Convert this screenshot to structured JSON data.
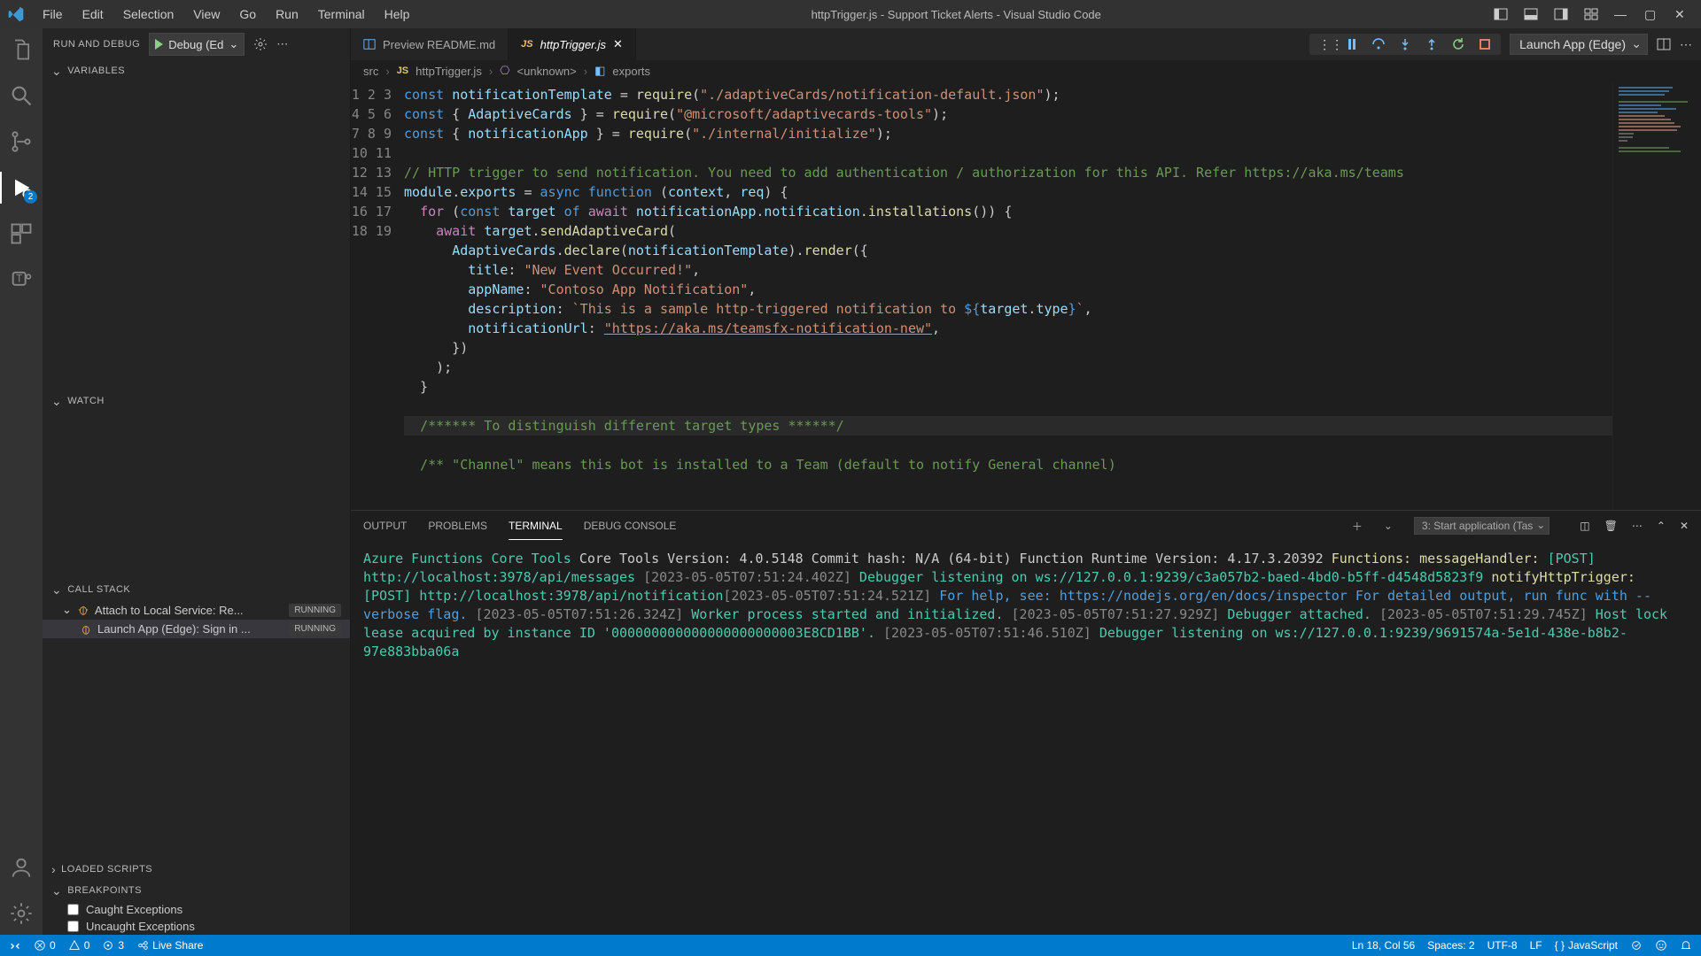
{
  "titlebar": {
    "menus": [
      "File",
      "Edit",
      "Selection",
      "View",
      "Go",
      "Run",
      "Terminal",
      "Help"
    ],
    "title": "httpTrigger.js - Support Ticket Alerts - Visual Studio Code"
  },
  "debugbar": {
    "label": "RUN AND DEBUG",
    "config": "Debug (Ed"
  },
  "sections": {
    "variables": "VARIABLES",
    "watch": "WATCH",
    "callstack": "CALL STACK",
    "loaded": "LOADED SCRIPTS",
    "breakpoints": "BREAKPOINTS"
  },
  "callstack": {
    "items": [
      {
        "label": "Attach to Local Service: Re...",
        "status": "RUNNING"
      },
      {
        "label": "Launch App (Edge): Sign in ...",
        "status": "RUNNING"
      }
    ]
  },
  "breakpoints": {
    "items": [
      "Caught Exceptions",
      "Uncaught Exceptions"
    ]
  },
  "tabs": {
    "preview": "Preview README.md",
    "active": "httpTrigger.js",
    "launch_sel": "Launch App (Edge)"
  },
  "breadcrumb": {
    "src": "src",
    "file": "httpTrigger.js",
    "unknown": "<unknown>",
    "exports": "exports"
  },
  "code": {
    "notificationTemplate": "notificationTemplate",
    "AdaptiveCards": "AdaptiveCards",
    "notificationApp": "notificationApp",
    "path1": "\"./adaptiveCards/notification-default.json\"",
    "path2": "\"@microsoft/adaptivecards-tools\"",
    "path3": "\"./internal/initialize\"",
    "cmt": "// HTTP trigger to send notification. You need to add authentication / authorization for this API. Refer https://aka.ms/teams",
    "title_line": "\"New Event Occurred!\"",
    "appName": "\"Contoso App Notification\"",
    "desc_pre": "`This is a sample http-triggered notification to ",
    "desc_post": "`",
    "notif_url": "\"https://aka.ms/teamsfx-notification-new\"",
    "block": "/****** To distinguish different target types ******/",
    "channel": "/** \"Channel\" means this bot is installed to a Team (default to notify General channel)"
  },
  "panel": {
    "tabs": [
      "OUTPUT",
      "PROBLEMS",
      "TERMINAL",
      "DEBUG CONSOLE"
    ],
    "task": "3: Start application (Tas"
  },
  "terminal": {
    "t1": "Azure Functions Core Tools",
    "t2": "Core Tools Version:       4.0.5148 Commit hash: N/A  (64-bit)",
    "t3": "Function Runtime Version: 4.17.3.20392",
    "fns": "Functions:",
    "mh": "messageHandler:",
    "post1": "[POST] http://localhost:3978/api/messages",
    "ts1": "[2023-05-05T07:51:24.402Z]",
    "dbg1": "Debugger listening on ws://127.0.0.1:9239/c3a057b2-baed-4bd0-b5ff-d4548d5823f9",
    "nh": "notifyHttpTrigger:",
    "post2": "[POST] http://localhost:3978/api/notification",
    "ts2": "[2023-05-05T07:51:24.521Z]",
    "help": "For help, see: https://nodejs.org/en/docs/inspector",
    "det": "For detailed output, run func with --verbose flag.",
    "ts3": "[2023-05-05T07:51:26.324Z]",
    "l3": "Worker process started and initialized.",
    "ts4": "[2023-05-05T07:51:27.929Z]",
    "l4": "Debugger attached.",
    "ts5": "[2023-05-05T07:51:29.745Z]",
    "l5": "Host lock lease acquired by instance ID '000000000000000000000003E8CD1BB'.",
    "ts6": "[2023-05-05T07:51:46.510Z]",
    "l6": "Debugger listening on ws://127.0.0.1:9239/9691574a-5e1d-438e-b8b2-97e883bba06a"
  },
  "status": {
    "errors": "0",
    "warnings": "0",
    "ports": "3",
    "liveshare": "Live Share",
    "cursor": "Ln 18, Col 56",
    "spaces": "Spaces: 2",
    "enc": "UTF-8",
    "eol": "LF",
    "lang": "JavaScript"
  }
}
